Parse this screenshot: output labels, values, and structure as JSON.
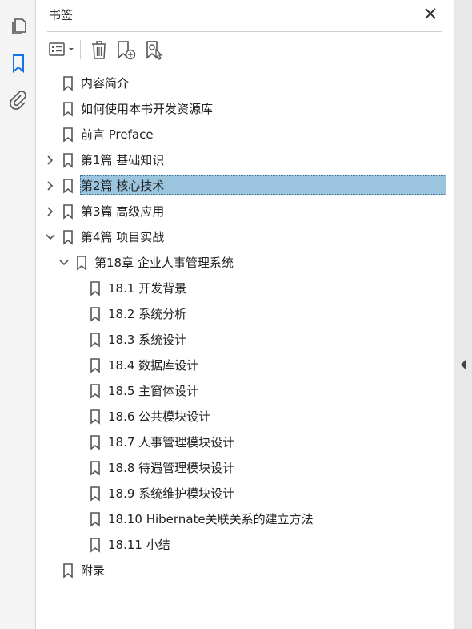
{
  "panel": {
    "title": "书签"
  },
  "rail": {
    "items": [
      {
        "name": "pages-icon",
        "active": false
      },
      {
        "name": "bookmark-icon",
        "active": true
      },
      {
        "name": "attachment-icon",
        "active": false
      }
    ]
  },
  "toolbar": {
    "items": [
      "options-icon",
      "delete-icon",
      "new-bookmark-icon",
      "new-bookmark-from-structure-icon"
    ]
  },
  "bookmarks": [
    {
      "label": "内容简介",
      "level": 0,
      "chevron": "none",
      "selected": false
    },
    {
      "label": "如何使用本书开发资源库",
      "level": 0,
      "chevron": "none",
      "selected": false
    },
    {
      "label": "前言 Preface",
      "level": 0,
      "chevron": "none",
      "selected": false
    },
    {
      "label": "第1篇 基础知识",
      "level": 0,
      "chevron": "right",
      "selected": false
    },
    {
      "label": "第2篇 核心技术",
      "level": 0,
      "chevron": "right",
      "selected": true
    },
    {
      "label": "第3篇 高级应用",
      "level": 0,
      "chevron": "right",
      "selected": false
    },
    {
      "label": "第4篇 项目实战",
      "level": 0,
      "chevron": "down",
      "selected": false
    },
    {
      "label": "第18章 企业人事管理系统",
      "level": 1,
      "chevron": "down",
      "selected": false
    },
    {
      "label": "18.1 开发背景",
      "level": 2,
      "chevron": "none",
      "selected": false
    },
    {
      "label": "18.2 系统分析",
      "level": 2,
      "chevron": "none",
      "selected": false
    },
    {
      "label": "18.3 系统设计",
      "level": 2,
      "chevron": "none",
      "selected": false
    },
    {
      "label": "18.4 数据库设计",
      "level": 2,
      "chevron": "none",
      "selected": false
    },
    {
      "label": "18.5 主窗体设计",
      "level": 2,
      "chevron": "none",
      "selected": false
    },
    {
      "label": "18.6 公共模块设计",
      "level": 2,
      "chevron": "none",
      "selected": false
    },
    {
      "label": "18.7 人事管理模块设计",
      "level": 2,
      "chevron": "none",
      "selected": false
    },
    {
      "label": "18.8 待遇管理模块设计",
      "level": 2,
      "chevron": "none",
      "selected": false
    },
    {
      "label": "18.9 系统维护模块设计",
      "level": 2,
      "chevron": "none",
      "selected": false
    },
    {
      "label": "18.10 Hibernate关联关系的建立方法",
      "level": 2,
      "chevron": "none",
      "selected": false
    },
    {
      "label": "18.11 小结",
      "level": 2,
      "chevron": "none",
      "selected": false
    },
    {
      "label": "附录",
      "level": 0,
      "chevron": "none",
      "selected": false
    }
  ],
  "colors": {
    "accent": "#1473e6",
    "selection": "#9bc4de",
    "icon": "#555555"
  }
}
